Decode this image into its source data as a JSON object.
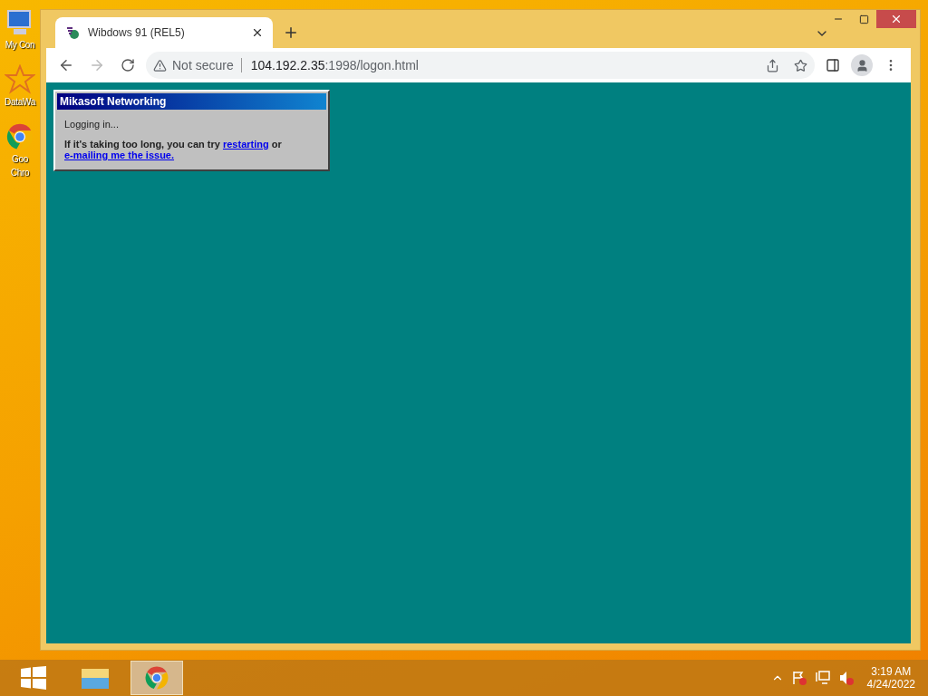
{
  "desktop_icons": [
    {
      "kind": "computer",
      "label": "My Con"
    },
    {
      "kind": "app",
      "label": "DataWa"
    },
    {
      "kind": "chrome",
      "label": "Goo\nChro"
    }
  ],
  "browser": {
    "tab": {
      "title": "Wibdows 91 (REL5)"
    },
    "address_bar": {
      "security": "Not secure",
      "host": "104.192.2.35",
      "path": ":1998/logon.html"
    }
  },
  "dialog": {
    "title": "Mikasoft Networking",
    "status": "Logging in...",
    "message_before": "If it's taking too long, you can try ",
    "link_restart": "restarting",
    "message_middle": " or ",
    "link_email": "e-mailing me the issue."
  },
  "taskbar": {
    "time": "3:19 AM",
    "date": "4/24/2022"
  }
}
